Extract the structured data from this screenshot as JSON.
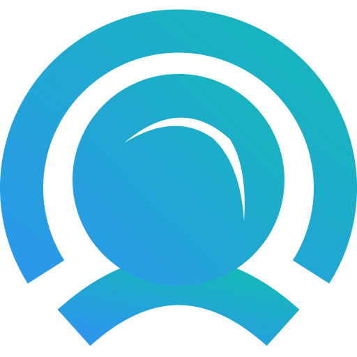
{
  "logo": {
    "icon": "user-webcam-icon",
    "colors": {
      "gradient_start": "#2b98ea",
      "gradient_end": "#14b8b9",
      "highlight": "#ffffff",
      "background": "#ffffff"
    }
  }
}
